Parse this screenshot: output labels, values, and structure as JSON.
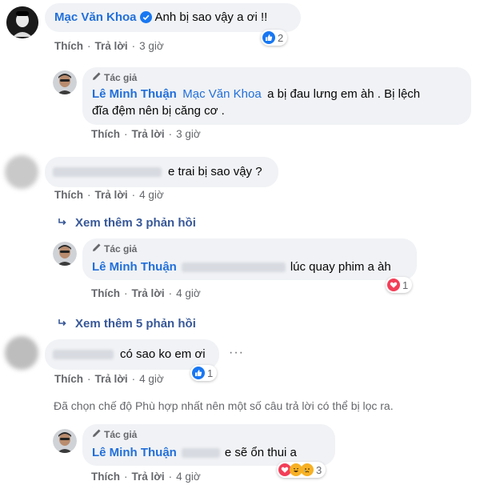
{
  "comments": {
    "c1": {
      "name": "Mạc Văn Khoa",
      "text": "Anh bị sao vậy a ơi !!",
      "like": "Thích",
      "reply": "Trả lời",
      "time": "3 giờ",
      "reaction_count": "2"
    },
    "r1": {
      "author_badge": "Tác giả",
      "name": "Lê Minh Thuận",
      "tag": "Mạc Văn Khoa",
      "text_line1": "a bị đau lưng em àh . Bị lệch",
      "text_line2": "đĩa đệm nên bị căng cơ .",
      "like": "Thích",
      "reply": "Trả lời",
      "time": "3 giờ"
    },
    "c2": {
      "text": "e trai bị sao vậy ?",
      "like": "Thích",
      "reply": "Trả lời",
      "time": "4 giờ"
    },
    "more1": {
      "label": "Xem thêm 3 phản hồi"
    },
    "r2": {
      "author_badge": "Tác giả",
      "name": "Lê Minh Thuận",
      "text": "lúc quay phim a àh",
      "like": "Thích",
      "reply": "Trả lời",
      "time": "4 giờ",
      "reaction_count": "1"
    },
    "more2": {
      "label": "Xem thêm 5 phản hồi"
    },
    "c3": {
      "text": "có sao ko em ơi",
      "like": "Thích",
      "reply": "Trả lời",
      "time": "4 giờ",
      "reaction_count": "1"
    },
    "filter_notice": "Đã chọn chế độ Phù hợp nhất nên một số câu trả lời có thể bị lọc ra.",
    "r3": {
      "author_badge": "Tác giả",
      "name": "Lê Minh Thuận",
      "text": "e sẽ ổn thui a",
      "like": "Thích",
      "reply": "Trả lời",
      "time": "4 giờ",
      "reaction_count": "3"
    }
  },
  "icons": [
    "verified-badge-icon",
    "pencil-icon",
    "like-icon",
    "love-icon",
    "haha-icon",
    "sad-icon",
    "reply-arrow-icon",
    "more-dots-icon"
  ],
  "colors": {
    "name_blue": "#216fdb",
    "link_blue": "#385898",
    "bubble": "#f0f2f5",
    "meta_gray": "#65676b",
    "like_blue": "#1877f2",
    "love_red": "#f33e58"
  }
}
